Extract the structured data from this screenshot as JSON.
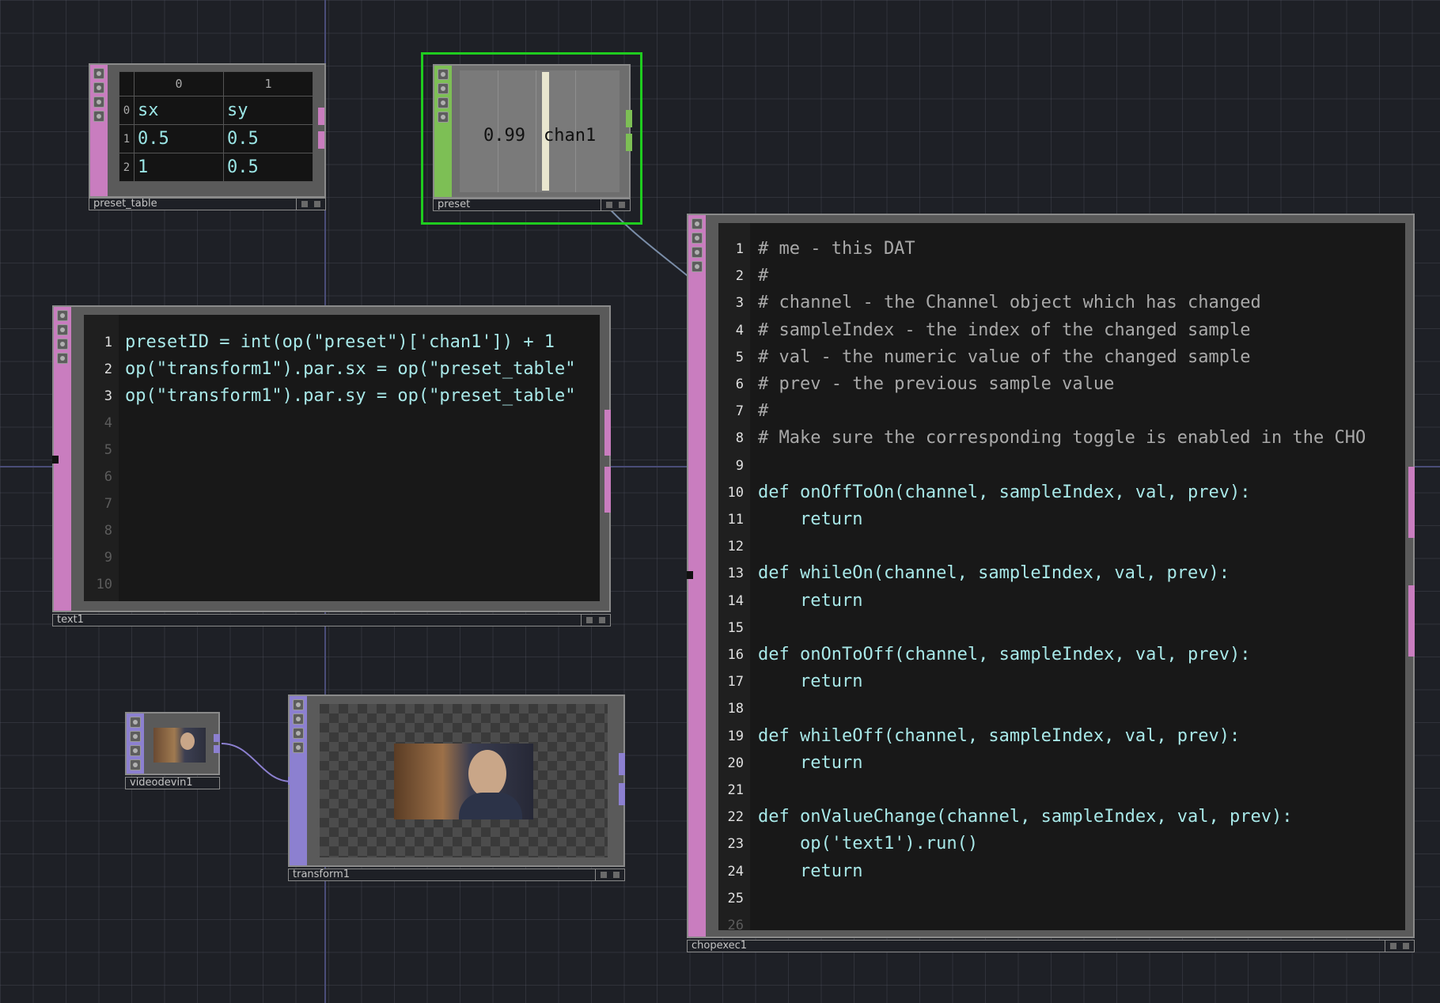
{
  "nodes": {
    "preset_table": {
      "name": "preset_table",
      "columns": [
        "0",
        "1"
      ],
      "rows": [
        {
          "index": "0",
          "cells": [
            "sx",
            "sy"
          ]
        },
        {
          "index": "1",
          "cells": [
            "0.5",
            "0.5"
          ]
        },
        {
          "index": "2",
          "cells": [
            "1",
            "0.5"
          ]
        }
      ]
    },
    "preset": {
      "name": "preset",
      "value": "0.99",
      "channel": "chan1"
    },
    "text1": {
      "name": "text1",
      "lines": [
        {
          "n": "1",
          "text": "presetID = int(op(\"preset\")['chan1']) + 1"
        },
        {
          "n": "2",
          "text": "op(\"transform1\").par.sx = op(\"preset_table\""
        },
        {
          "n": "3",
          "text": "op(\"transform1\").par.sy = op(\"preset_table\""
        },
        {
          "n": "4",
          "text": ""
        },
        {
          "n": "5",
          "text": ""
        },
        {
          "n": "6",
          "text": ""
        },
        {
          "n": "7",
          "text": ""
        },
        {
          "n": "8",
          "text": ""
        },
        {
          "n": "9",
          "text": ""
        },
        {
          "n": "10",
          "text": ""
        }
      ]
    },
    "videodevin1": {
      "name": "videodevin1"
    },
    "transform1": {
      "name": "transform1"
    },
    "chopexec1": {
      "name": "chopexec1",
      "lines": [
        {
          "n": "1",
          "text": "# me - this DAT",
          "kind": "comment"
        },
        {
          "n": "2",
          "text": "#",
          "kind": "comment"
        },
        {
          "n": "3",
          "text": "# channel - the Channel object which has changed",
          "kind": "comment"
        },
        {
          "n": "4",
          "text": "# sampleIndex - the index of the changed sample",
          "kind": "comment"
        },
        {
          "n": "5",
          "text": "# val - the numeric value of the changed sample",
          "kind": "comment"
        },
        {
          "n": "6",
          "text": "# prev - the previous sample value",
          "kind": "comment"
        },
        {
          "n": "7",
          "text": "#",
          "kind": "comment"
        },
        {
          "n": "8",
          "text": "# Make sure the corresponding toggle is enabled in the CHO",
          "kind": "comment"
        },
        {
          "n": "9",
          "text": "",
          "kind": "code"
        },
        {
          "n": "10",
          "text": "def onOffToOn(channel, sampleIndex, val, prev):",
          "kind": "code"
        },
        {
          "n": "11",
          "text": "    return",
          "kind": "code"
        },
        {
          "n": "12",
          "text": "",
          "kind": "code"
        },
        {
          "n": "13",
          "text": "def whileOn(channel, sampleIndex, val, prev):",
          "kind": "code"
        },
        {
          "n": "14",
          "text": "    return",
          "kind": "code"
        },
        {
          "n": "15",
          "text": "",
          "kind": "code"
        },
        {
          "n": "16",
          "text": "def onOnToOff(channel, sampleIndex, val, prev):",
          "kind": "code"
        },
        {
          "n": "17",
          "text": "    return",
          "kind": "code"
        },
        {
          "n": "18",
          "text": "",
          "kind": "code"
        },
        {
          "n": "19",
          "text": "def whileOff(channel, sampleIndex, val, prev):",
          "kind": "code"
        },
        {
          "n": "20",
          "text": "    return",
          "kind": "code"
        },
        {
          "n": "21",
          "text": "",
          "kind": "code"
        },
        {
          "n": "22",
          "text": "def onValueChange(channel, sampleIndex, val, prev):",
          "kind": "code"
        },
        {
          "n": "23",
          "text": "    op('text1').run()",
          "kind": "code"
        },
        {
          "n": "24",
          "text": "    return",
          "kind": "code"
        },
        {
          "n": "25",
          "text": "",
          "kind": "code"
        },
        {
          "n": "26",
          "text": "",
          "kind": "code"
        }
      ]
    }
  },
  "colors": {
    "dat": "#c97dbf",
    "chop": "#7dbf55",
    "top": "#8c80d0",
    "selected": "#1fcc1f",
    "code_text": "#a8e8e8",
    "comment_text": "#a9a9a9"
  },
  "icons": [
    "viewer-active-icon",
    "bypass-icon",
    "display-flag-icon",
    "render-flag-icon"
  ]
}
